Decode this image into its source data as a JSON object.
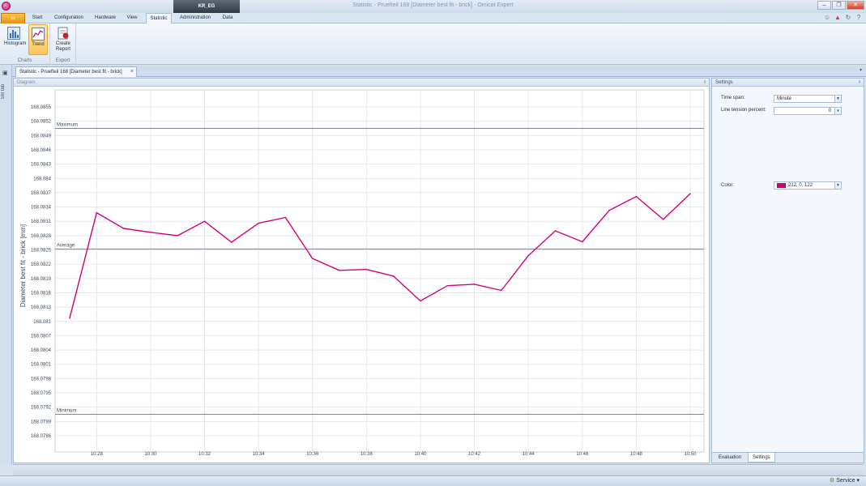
{
  "window": {
    "title": "Statistic - Pruefteil 168 [Diameter best fit - brick] - Omicat Expert",
    "context_tab": "KR_EG"
  },
  "ribbon": {
    "file_label": "",
    "tabs": [
      "Start",
      "Configuration",
      "Hardware",
      "View",
      "Statistic",
      "Administration",
      "Data"
    ],
    "active_tab": "Statistic",
    "groups": {
      "charts": {
        "label": "Charts",
        "histogram": "Histogram",
        "trend": "Trend"
      },
      "export": {
        "label": "Export",
        "create_report": "Create Report"
      }
    }
  },
  "left_strip": {
    "label": "Stil tab"
  },
  "document_tab": {
    "label": "Statistic - Pruefteil 168 [Diameter best fit - brick]"
  },
  "diagram_panel": {
    "title": "Diagram"
  },
  "settings_panel": {
    "title": "Settings",
    "time_span_label": "Time span:",
    "time_span_value": "Minute",
    "line_tension_label": "Line tension percent:",
    "line_tension_value": "0",
    "color_label": "Color:",
    "color_value": "212, 0, 122",
    "color_hex": "#d4007a",
    "tabs": [
      "Evaluation",
      "Settings"
    ],
    "active_tab": "Settings"
  },
  "statusbar": {
    "service_label": "Service"
  },
  "chart_data": {
    "type": "line",
    "ylabel": "Diameter best fit - brick [mm]",
    "xlabel": "",
    "yticks": [
      "168.0855",
      "168.0852",
      "168.0849",
      "168.0846",
      "168.0843",
      "168.084",
      "168.0837",
      "168.0834",
      "168.0831",
      "168.0828",
      "168.0825",
      "168.0822",
      "168.0819",
      "168.0816",
      "168.0813",
      "168.081",
      "168.0807",
      "168.0804",
      "168.0801",
      "168.0798",
      "168.0795",
      "168.0792",
      "168.0789",
      "168.0786"
    ],
    "ylim": [
      168.0786,
      168.0855
    ],
    "xticks": [
      "10:28",
      "10:30",
      "10:32",
      "10:34",
      "10:36",
      "10:38",
      "10:40",
      "10:42",
      "10:44",
      "10:46",
      "10:48",
      "10:50"
    ],
    "x": [
      "10:27",
      "10:28",
      "10:29",
      "10:30",
      "10:31",
      "10:32",
      "10:33",
      "10:34",
      "10:35",
      "10:36",
      "10:37",
      "10:38",
      "10:39",
      "10:40",
      "10:41",
      "10:42",
      "10:43",
      "10:44",
      "10:45",
      "10:46",
      "10:47",
      "10:48",
      "10:49",
      "10:50"
    ],
    "series": [
      {
        "color": "#d4007a",
        "values": [
          168.08107,
          168.08328,
          168.08295,
          168.08287,
          168.0828,
          168.0831,
          168.08266,
          168.08306,
          168.08318,
          168.08232,
          168.08207,
          168.08209,
          168.08195,
          168.08143,
          168.08175,
          168.08178,
          168.08165,
          168.08238,
          168.0829,
          168.08267,
          168.08333,
          168.08362,
          168.08314,
          168.08368
        ]
      }
    ],
    "reference_lines": [
      {
        "label": "Maximum",
        "value": 168.08505
      },
      {
        "label": "Average",
        "value": 168.08252
      },
      {
        "label": "Minimum",
        "value": 168.07905
      }
    ],
    "grid": true,
    "legend": "none"
  }
}
